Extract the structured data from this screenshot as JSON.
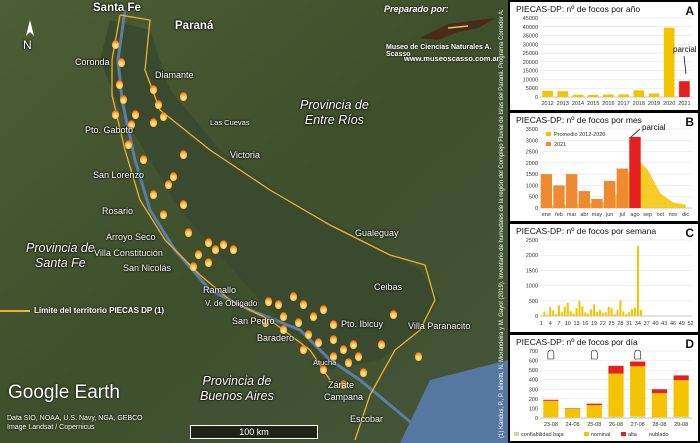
{
  "map": {
    "provider_logo": "Google Earth",
    "credits_line1": "Data SIO, NOAA, U.S. Navy, NGA, GEBCO",
    "credits_line2": "Image Landsat / Copernicus",
    "scale_label": "100 km",
    "compass_letter": "N",
    "legend_text": "Límite del territorio PIECAS DP (1)",
    "prepared_by": "Preparado por:",
    "museum_name": "Museo de Ciencias Naturales A. Scasso",
    "website": "www.museoscasso.com.ar",
    "reference_note": "(1) Kandus, P., P. Minotti, N. Morandeira y M. Gayol (2019). Inventario de humedales de la región del Complejo Fluvial de Islas del Paraná. Programa Corredor Azul, Fundación Humedales / Wetlands International y Universidad Nacional de San Martín, Buenos Aires, Argentina.",
    "provinces": [
      {
        "id": "entre-rios",
        "line1": "Provincia de",
        "line2": "Entre Ríos"
      },
      {
        "id": "santa-fe",
        "line1": "Provincia de",
        "line2": "Santa Fe"
      },
      {
        "id": "buenos-aires",
        "line1": "Provincia de",
        "line2": "Buenos Aires"
      }
    ],
    "cities": [
      {
        "id": "santa-fe",
        "name": "Santa Fe",
        "major": true
      },
      {
        "id": "parana",
        "name": "Paraná",
        "major": true
      },
      {
        "id": "coronda",
        "name": "Coronda"
      },
      {
        "id": "diamante",
        "name": "Diamante"
      },
      {
        "id": "las-cuevas",
        "name": "Las Cuevas"
      },
      {
        "id": "pto-gaboto",
        "name": "Pto. Gaboto"
      },
      {
        "id": "victoria",
        "name": "Victoria"
      },
      {
        "id": "san-lorenzo",
        "name": "San Lorenzo"
      },
      {
        "id": "rosario",
        "name": "Rosario"
      },
      {
        "id": "gualeguay",
        "name": "Gualeguay"
      },
      {
        "id": "arroyo-seco",
        "name": "Arroyo Seco"
      },
      {
        "id": "villa-constitucion",
        "name": "Villa Constitución"
      },
      {
        "id": "san-nicolas",
        "name": "San Nicolás"
      },
      {
        "id": "ramallo",
        "name": "Ramallo"
      },
      {
        "id": "v-de-obligado",
        "name": "V. de Obligado"
      },
      {
        "id": "ceibas",
        "name": "Ceibas"
      },
      {
        "id": "san-pedro",
        "name": "San Pedro"
      },
      {
        "id": "pto-ibicuy",
        "name": "Pto. Ibicuy"
      },
      {
        "id": "villa-paranacito",
        "name": "Villa Paranacito"
      },
      {
        "id": "baradero",
        "name": "Baradero"
      },
      {
        "id": "atucha",
        "name": "Atucha"
      },
      {
        "id": "zarate",
        "name": "Zárate"
      },
      {
        "id": "campana",
        "name": "Campana"
      },
      {
        "id": "escobar",
        "name": "Escobar"
      }
    ],
    "colors": {
      "boundary": "#f0b030",
      "fire": "#ff7a10",
      "water": "#5a7ea6"
    }
  },
  "chart_data": [
    {
      "id": "A",
      "type": "bar",
      "title": "PIECAS-DP: nº de focos por año",
      "categories": [
        "2012",
        "2013",
        "2014",
        "2015",
        "2016",
        "2017",
        "2018",
        "2019",
        "2020",
        "2021"
      ],
      "values": [
        3500,
        3300,
        1300,
        1200,
        1400,
        1500,
        3800,
        2000,
        39500,
        9000
      ],
      "colors": [
        "#f4c400",
        "#f4c400",
        "#f4c400",
        "#f4c400",
        "#f4c400",
        "#f4c400",
        "#f4c400",
        "#f4c400",
        "#f4c400",
        "#e62020"
      ],
      "yticks": [
        "0",
        "5000",
        "10000",
        "15000",
        "20000",
        "25000",
        "30000",
        "35000",
        "40000",
        "45000"
      ],
      "ylim": [
        0,
        45000
      ],
      "annotation": "parcial"
    },
    {
      "id": "B",
      "type": "bar",
      "title": "PIECAS-DP: nº de focos por mes",
      "categories": [
        "ene",
        "feb",
        "mar",
        "abr",
        "may",
        "jun",
        "jul",
        "ago",
        "sep",
        "oct",
        "nov",
        "dic"
      ],
      "series": [
        {
          "name": "Promedio 2012-2020",
          "type": "area",
          "color": "#f4c400",
          "values": [
            120,
            140,
            180,
            200,
            230,
            300,
            900,
            2250,
            1700,
            650,
            250,
            150
          ]
        },
        {
          "name": "2021",
          "type": "bar",
          "color": "#f08a30",
          "values": [
            1500,
            1000,
            1500,
            750,
            400,
            1200,
            1750,
            3150,
            0,
            0,
            0,
            0
          ]
        }
      ],
      "highlight": {
        "category": "ago",
        "color": "#e62020"
      },
      "yticks": [
        "0",
        "500",
        "1000",
        "1500",
        "2000",
        "2500",
        "3000",
        "3500"
      ],
      "ylim": [
        0,
        3500
      ],
      "annotation": "parcial"
    },
    {
      "id": "C",
      "type": "bar",
      "title": "PIECAS-DP: nº de focos por semana",
      "categories": [
        "1",
        "4",
        "7",
        "10",
        "13",
        "16",
        "19",
        "22",
        "25",
        "28",
        "31",
        "34",
        "37",
        "40",
        "43",
        "46",
        "49",
        "52"
      ],
      "values": [
        20,
        140,
        40,
        300,
        180,
        60,
        350,
        120,
        300,
        440,
        160,
        80,
        260,
        500,
        320,
        120,
        80,
        220,
        380,
        140,
        200,
        100,
        120,
        300,
        260,
        60,
        200,
        520,
        150,
        60,
        120,
        240,
        280,
        2300,
        200,
        0,
        0,
        0,
        0,
        0,
        0,
        0,
        0,
        0,
        0,
        0,
        0,
        0,
        0,
        0,
        0,
        0
      ],
      "color": "#f4c400",
      "yticks": [
        "0",
        "500",
        "1000",
        "1500",
        "2000",
        "2500"
      ],
      "ylim": [
        0,
        2500
      ]
    },
    {
      "id": "D",
      "type": "bar",
      "stacked": true,
      "title": "PIECAS-DP: nº de focos por día",
      "categories": [
        "23-08",
        "24-08",
        "25-08",
        "26-08",
        "27-08",
        "28-08",
        "29-08"
      ],
      "series": [
        {
          "name": "confiabilidad baja",
          "color": "#c8d8a0",
          "values": [
            10,
            5,
            5,
            15,
            20,
            10,
            15
          ]
        },
        {
          "name": "nominal",
          "color": "#f4c400",
          "values": [
            170,
            90,
            130,
            450,
            520,
            250,
            380
          ]
        },
        {
          "name": "alta",
          "color": "#e62020",
          "values": [
            10,
            5,
            15,
            80,
            50,
            40,
            50
          ]
        }
      ],
      "cloudy_label": "nublado",
      "yticks": [
        "0",
        "100",
        "200",
        "300",
        "400",
        "500",
        "600",
        "700"
      ],
      "ylim": [
        0,
        700
      ]
    }
  ]
}
